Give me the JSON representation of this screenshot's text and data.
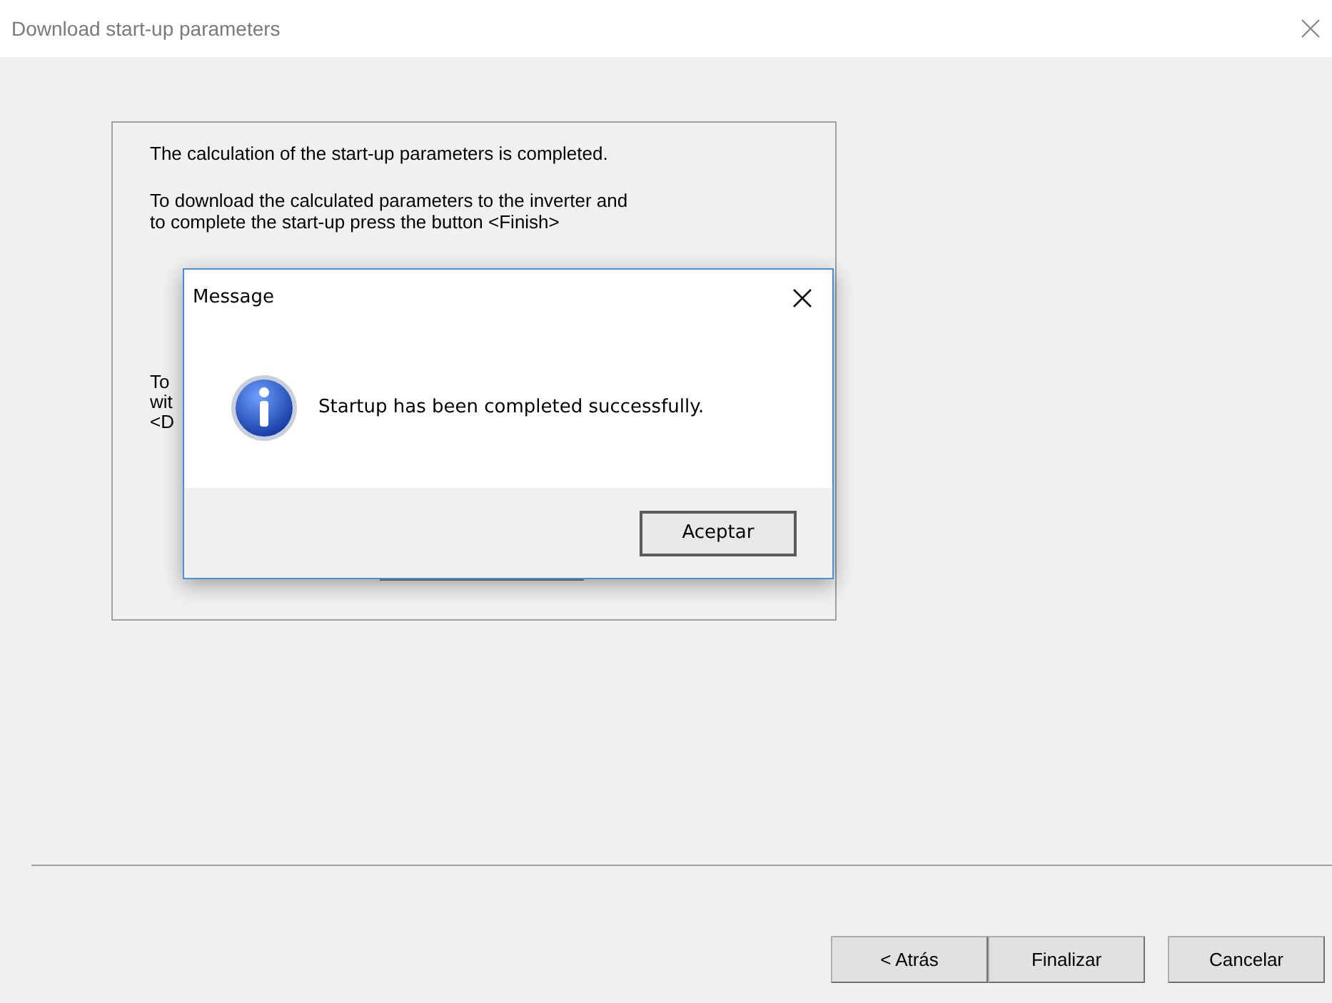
{
  "window": {
    "title": "Download start-up parameters"
  },
  "panel": {
    "paragraphs": [
      "The calculation of the start-up parameters is completed.",
      "To download the calculated parameters to the inverter and\nto complete the start-up press the button <Finish>"
    ],
    "covered_lines": [
      "To",
      "wit",
      "<D"
    ]
  },
  "message_box": {
    "title": "Message",
    "text": "Startup has been completed successfully.",
    "buttons": [
      "Aceptar"
    ]
  },
  "buttons": [
    "< Atrás",
    "Finalizar",
    "Cancelar"
  ]
}
